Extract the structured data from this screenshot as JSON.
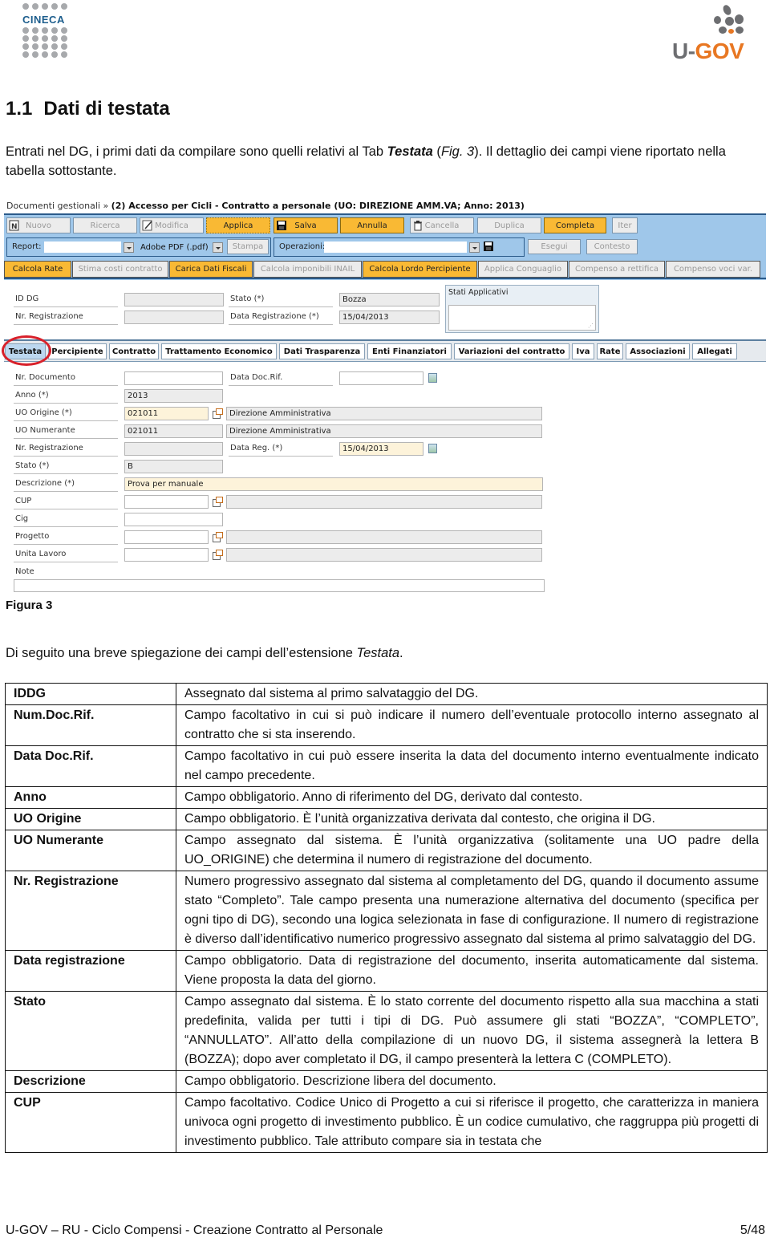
{
  "header": {
    "left_logo": "CINECA",
    "right_logo_u": "U-",
    "right_logo_gov": "GOV"
  },
  "section": {
    "number": "1.1",
    "title": "Dati di testata",
    "intro_pre": "Entrati nel DG, i primi dati da compilare sono quelli relativi al Tab ",
    "intro_bold": "Testata",
    "intro_mid": " (",
    "intro_fig": "Fig. 3",
    "intro_post": "). Il dettaglio dei campi viene riportato nella tabella sottostante."
  },
  "figure": {
    "breadcrumb_root": "Documenti gestionali »",
    "breadcrumb_title": "(2) Accesso per Cicli - Contratto a personale (UO: DIREZIONE AMM.VA; Anno: 2013)",
    "toolbar_buttons": [
      {
        "label": "Nuovo",
        "icon": "new-document-icon",
        "enabled": false
      },
      {
        "label": "Ricerca",
        "icon": "",
        "enabled": false
      },
      {
        "label": "Modifica",
        "icon": "edit-pencil-icon",
        "enabled": false
      },
      {
        "label": "Applica",
        "icon": "",
        "enabled": true
      },
      {
        "label": "Salva",
        "icon": "floppy-disk-icon",
        "enabled": true
      },
      {
        "label": "Annulla",
        "icon": "",
        "enabled": true
      },
      {
        "label": "Cancella",
        "icon": "trash-icon",
        "enabled": false
      },
      {
        "label": "Duplica",
        "icon": "",
        "enabled": false
      },
      {
        "label": "Completa",
        "icon": "",
        "enabled": true
      },
      {
        "label": "Iter",
        "icon": "",
        "enabled": false
      }
    ],
    "report_label": "Report:",
    "report_value": "",
    "format_value": "Adobe PDF (.pdf)",
    "stampa_label": "Stampa",
    "operazioni_label": "Operazioni:",
    "operazioni_value": "",
    "esegui_label": "Esegui",
    "contesto_label": "Contesto",
    "action_buttons": [
      {
        "label": "Calcola Rate",
        "enabled": true
      },
      {
        "label": "Stima costi contratto",
        "enabled": false
      },
      {
        "label": "Carica Dati Fiscali",
        "enabled": true
      },
      {
        "label": "Calcola imponibili INAIL",
        "enabled": false
      },
      {
        "label": "Calcola Lordo Percipiente",
        "enabled": true
      },
      {
        "label": "Applica Conguaglio",
        "enabled": false
      },
      {
        "label": "Compenso a rettifica",
        "enabled": false
      },
      {
        "label": "Compenso voci var.",
        "enabled": false
      }
    ],
    "top_fields": {
      "id_dg_label": "ID DG",
      "id_dg_value": "",
      "nr_reg_label": "Nr. Registrazione",
      "nr_reg_value": "",
      "stato_label": "Stato (*)",
      "stato_value": "Bozza",
      "data_reg_label": "Data Registrazione (*)",
      "data_reg_value": "15/04/2013",
      "stati_applicativi_label": "Stati Applicativi"
    },
    "tabs": [
      "Testata",
      "Percipiente",
      "Contratto",
      "Trattamento Economico",
      "Dati Trasparenza",
      "Enti Finanziatori",
      "Variazioni del contratto",
      "Iva",
      "Rate",
      "Associazioni",
      "Allegati"
    ],
    "active_tab": "Testata",
    "form": {
      "nr_documento_label": "Nr. Documento",
      "nr_documento_value": "",
      "data_doc_rif_label": "Data Doc.Rif.",
      "data_doc_rif_value": "",
      "anno_label": "Anno (*)",
      "anno_value": "2013",
      "uo_origine_label": "UO Origine (*)",
      "uo_origine_code": "021011",
      "uo_origine_desc": "Direzione Amministrativa",
      "uo_numerante_label": "UO Numerante",
      "uo_numerante_code": "021011",
      "uo_numerante_desc": "Direzione Amministrativa",
      "nr_registrazione_label": "Nr. Registrazione",
      "nr_registrazione_value": "",
      "data_reg_label": "Data Reg. (*)",
      "data_reg_value": "15/04/2013",
      "stato_label": "Stato (*)",
      "stato_value": "B",
      "descrizione_label": "Descrizione (*)",
      "descrizione_value": "Prova per manuale",
      "cup_label": "CUP",
      "cup_value": "",
      "cig_label": "Cig",
      "cig_value": "",
      "progetto_label": "Progetto",
      "progetto_value": "",
      "unita_lavoro_label": "Unita Lavoro",
      "unita_lavoro_value": "",
      "note_label": "Note",
      "note_value": ""
    }
  },
  "figure_caption": "Figura 3",
  "explanation": {
    "pre": "Di seguito una breve spiegazione dei campi dell’estensione ",
    "italic": "Testata",
    "post": "."
  },
  "table": [
    {
      "field": "IDDG",
      "description": "Assegnato dal sistema al primo salvataggio del DG."
    },
    {
      "field": "Num.Doc.Rif.",
      "description": "Campo facoltativo in cui si può indicare il numero dell’eventuale protocollo interno assegnato al contratto che si sta inserendo."
    },
    {
      "field": "Data Doc.Rif.",
      "description": "Campo facoltativo in cui può essere inserita la data del documento interno eventualmente indicato nel campo precedente."
    },
    {
      "field": "Anno",
      "description": "Campo obbligatorio. Anno di riferimento del DG, derivato dal contesto."
    },
    {
      "field": "UO Origine",
      "description": "Campo obbligatorio. È l’unità organizzativa derivata dal contesto, che origina il DG."
    },
    {
      "field": "UO Numerante",
      "description": "Campo assegnato dal sistema. È l’unità organizzativa (solitamente una UO padre della UO_ORIGINE) che determina il numero di registrazione del documento."
    },
    {
      "field": "Nr. Registrazione",
      "description": "Numero progressivo assegnato dal sistema al completamento del DG, quando il documento assume stato “Completo”. Tale campo presenta una numerazione alternativa del documento (specifica per ogni tipo di DG), secondo una logica selezionata in fase di configurazione. Il numero di registrazione è diverso dall’identificativo numerico progressivo assegnato dal sistema al primo salvataggio del DG."
    },
    {
      "field": "Data registrazione",
      "description": "Campo obbligatorio. Data di registrazione del documento, inserita automaticamente dal sistema. Viene proposta la data del giorno."
    },
    {
      "field": "Stato",
      "description": "Campo assegnato dal sistema. È lo stato corrente del documento rispetto alla sua macchina a stati predefinita, valida per tutti i tipi di DG. Può assumere gli stati “BOZZA”, “COMPLETO”, “ANNULLATO”. All’atto della compilazione di un nuovo DG, il sistema assegnerà la lettera B (BOZZA); dopo aver completato il DG, il campo presenterà la lettera C (COMPLETO)."
    },
    {
      "field": "Descrizione",
      "description": "Campo obbligatorio. Descrizione libera del documento."
    },
    {
      "field": "CUP",
      "description": "Campo facoltativo. Codice Unico di Progetto a cui si riferisce il progetto, che caratterizza in maniera univoca ogni progetto di investimento pubblico. È un codice cumulativo, che raggruppa più progetti di investimento pubblico. Tale attributo compare sia in testata che"
    }
  ],
  "footer": {
    "left": "U-GOV – RU - Ciclo Compensi - Creazione Contratto al Personale",
    "page": "5/48"
  }
}
